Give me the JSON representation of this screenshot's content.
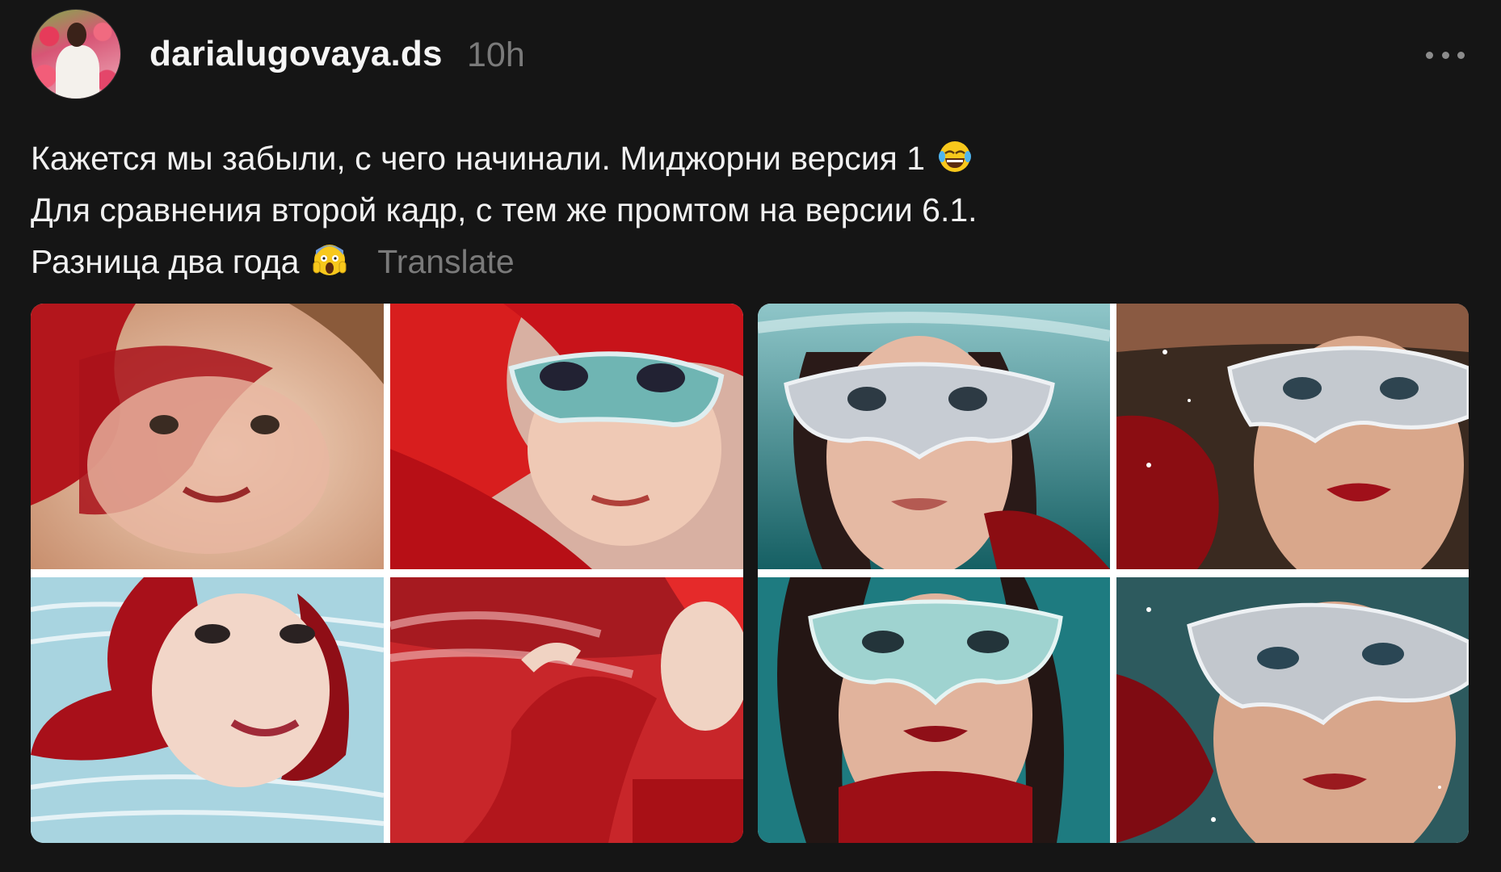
{
  "post": {
    "username": "darialugovaya.ds",
    "timestamp": "10h",
    "caption_lines": [
      "Кажется мы забыли, с чего начинали. Миджорни версия 1",
      "Для сравнения второй кадр, с тем же промтом на версии 6.1.",
      "Разница два года"
    ],
    "translate_label": "Translate",
    "emoji": [
      "face-with-tears-of-joy",
      "face-screaming-in-fear"
    ]
  },
  "images": [
    {
      "name": "midjourney-v1-collage",
      "tiles": 4,
      "palette": [
        "#c21a1a",
        "#f0d2b8",
        "#ffffff"
      ]
    },
    {
      "name": "midjourney-v6-collage",
      "tiles": 4,
      "palette": [
        "#1f6f73",
        "#8b0d12",
        "#c9cfd6"
      ]
    }
  ]
}
